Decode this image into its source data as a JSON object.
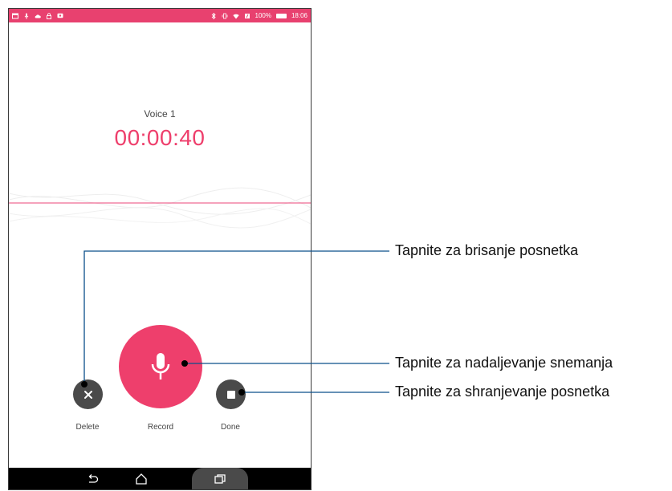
{
  "colors": {
    "status_bar": "#e8416f",
    "accent": "#ee3f6c",
    "dark_button": "#4a4a4a",
    "callout_line": "#0a4f8a",
    "wave_line": "#ef6a93"
  },
  "status_bar": {
    "battery_text": "100%",
    "time": "18:06"
  },
  "recording": {
    "title": "Voice 1",
    "elapsed": "00:00:40"
  },
  "controls": {
    "delete_label": "Delete",
    "record_label": "Record",
    "done_label": "Done"
  },
  "callouts": {
    "delete": "Tapnite za brisanje posnetka",
    "record": "Tapnite za nadaljevanje snemanja",
    "done": "Tapnite za shranjevanje posnetka"
  },
  "icons": [
    "close-icon",
    "microphone-icon",
    "stop-icon",
    "back-icon",
    "home-icon",
    "recents-icon"
  ]
}
